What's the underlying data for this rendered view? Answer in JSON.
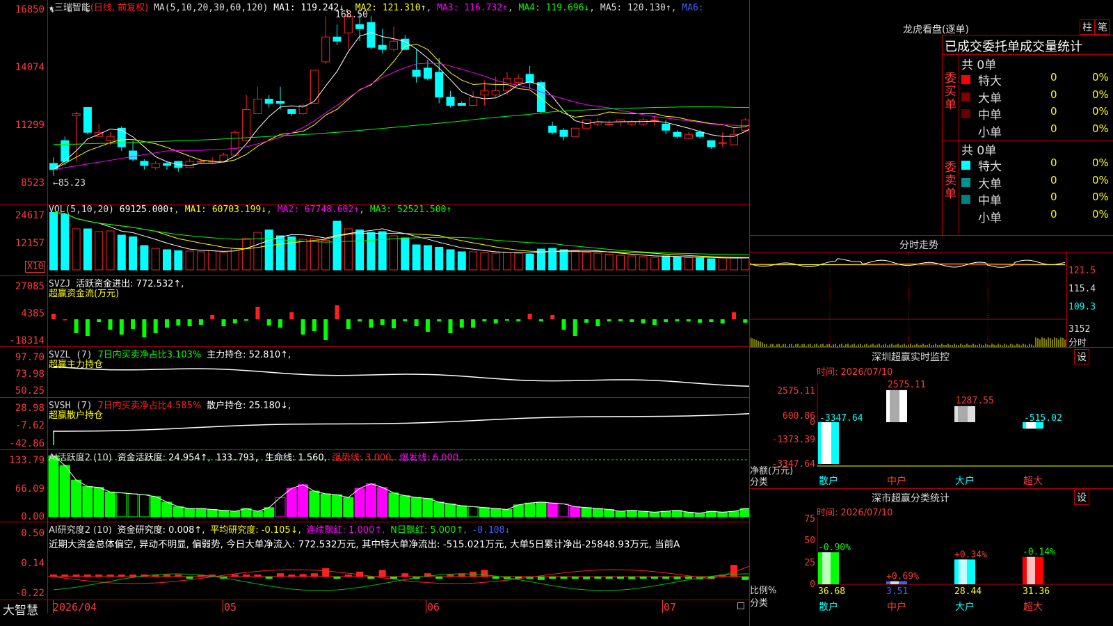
{
  "window": {
    "app_name": "大智慧"
  },
  "kline": {
    "stock": "三瑞智能",
    "period_tag": "(日线, 前复权)",
    "ma_prefix": "MA(5,10,20,30,60,120)",
    "ma1": "MA1: 119.242↓",
    "ma2": "MA2: 121.310↑",
    "ma3": "MA3: 116.732↑",
    "ma4": "MA4: 119.696↓",
    "ma5": "MA5: 120.130↑",
    "ma6": "MA6:",
    "y_ticks": [
      "16850",
      "14074",
      "11299",
      "8523"
    ],
    "high_label": "168.50",
    "low_label": "←85.23",
    "candles": [
      [
        95,
        92,
        89,
        98
      ],
      [
        106,
        96,
        94,
        108
      ],
      [
        118,
        119,
        96,
        120
      ],
      [
        122,
        110,
        109,
        122
      ],
      [
        108,
        110,
        108,
        114
      ],
      [
        106,
        108,
        104,
        110
      ],
      [
        112,
        103,
        101,
        113
      ],
      [
        101,
        97,
        96,
        106
      ],
      [
        96,
        94,
        92,
        97
      ],
      [
        93,
        95,
        92,
        96
      ],
      [
        95,
        94,
        92,
        96
      ],
      [
        96,
        93,
        91,
        96
      ],
      [
        93,
        96,
        93,
        97
      ],
      [
        96,
        96,
        95,
        97
      ],
      [
        96,
        96,
        95,
        98
      ],
      [
        96,
        99,
        96,
        100
      ],
      [
        99,
        110,
        99,
        111
      ],
      [
        106,
        121,
        106,
        128
      ],
      [
        119,
        126,
        119,
        132
      ],
      [
        126,
        124,
        122,
        128
      ],
      [
        125,
        124,
        121,
        132
      ],
      [
        121,
        119,
        118,
        121
      ],
      [
        119,
        123,
        118,
        124
      ],
      [
        124,
        140,
        124,
        140
      ],
      [
        144,
        156,
        143,
        166
      ],
      [
        156,
        154,
        152,
        162
      ],
      [
        158,
        166,
        150,
        168
      ],
      [
        162,
        160,
        154,
        168
      ],
      [
        163,
        151,
        150,
        166
      ],
      [
        152,
        150,
        148,
        160
      ],
      [
        150,
        154,
        149,
        161
      ],
      [
        155,
        150,
        150,
        157
      ],
      [
        140,
        137,
        134,
        150
      ],
      [
        141,
        136,
        135,
        145
      ],
      [
        139,
        127,
        124,
        146
      ],
      [
        127,
        123,
        122,
        130
      ],
      [
        124,
        123,
        123,
        125
      ],
      [
        123,
        127,
        123,
        130
      ],
      [
        128,
        130,
        123,
        135
      ],
      [
        128,
        130,
        127,
        137
      ],
      [
        130,
        136,
        128,
        139
      ],
      [
        134,
        136,
        133,
        138
      ],
      [
        138,
        134,
        131,
        142
      ],
      [
        134,
        120,
        119,
        135
      ],
      [
        113,
        110,
        109,
        115
      ],
      [
        111,
        108,
        106,
        112
      ],
      [
        108,
        112,
        108,
        112
      ],
      [
        112,
        116,
        112,
        116
      ],
      [
        114,
        115,
        113,
        117
      ],
      [
        114,
        114,
        113,
        116
      ],
      [
        115,
        116,
        113,
        116
      ],
      [
        114,
        115,
        113,
        116
      ],
      [
        114,
        116,
        113,
        117
      ],
      [
        116,
        116,
        113,
        118
      ],
      [
        114,
        111,
        109,
        116
      ],
      [
        110,
        108,
        107,
        111
      ],
      [
        107,
        109,
        107,
        110
      ],
      [
        110,
        108,
        107,
        111
      ],
      [
        106,
        103,
        102,
        106
      ],
      [
        105,
        105,
        103,
        110
      ],
      [
        104,
        109,
        104,
        112
      ],
      [
        111,
        116,
        110,
        117
      ],
      [
        115,
        118,
        115,
        123
      ],
      [
        118,
        134,
        118,
        145
      ],
      [
        129,
        139,
        129,
        143
      ],
      [
        143,
        145,
        134,
        152
      ],
      [
        141,
        130,
        127,
        142
      ],
      [
        129,
        120,
        118,
        132
      ],
      [
        114,
        118,
        113,
        124
      ],
      [
        115,
        112,
        110,
        117
      ],
      [
        115,
        114,
        113,
        116
      ],
      [
        116,
        120,
        115,
        123
      ],
      [
        120,
        127,
        119,
        126
      ]
    ],
    "ma_lines": {
      "ma5": [
        92.0,
        96.2,
        101.1,
        106.8,
        109.0,
        111.6,
        111.0,
        107.8,
        103.0,
        98.2,
        95.8,
        94.4,
        94.0,
        95.0,
        95.0,
        95.7,
        98.6,
        104.4,
        111.6,
        117.6,
        122.2,
        122.8,
        122.2,
        125.0,
        132.4,
        139.4,
        149.0,
        156.4,
        158.2,
        156.2,
        155.2,
        153.8,
        150.2,
        145.8,
        141.0,
        135.4,
        129.6,
        127.2,
        126.2,
        126.6,
        129.2,
        133.0,
        134.4,
        132.6,
        127.2,
        120.4,
        115.6,
        114.2,
        115.1,
        114.9,
        115.1,
        115.2,
        115.2,
        115.4,
        114.8,
        113.4,
        112.0,
        110.4,
        108.8,
        108.0,
        108.0,
        110.4,
        113.4,
        120.4,
        127.2,
        134.4,
        138.0,
        137.6,
        133.8,
        125.6,
        117.8,
        114.8,
        117.6
      ],
      "ma10": [
        92.0,
        95.0,
        98.0,
        101.0,
        103.0,
        105.0,
        106.5,
        106.5,
        105.5,
        104.5,
        102.7,
        100.6,
        98.5,
        96.6,
        96.1,
        95.6,
        96.7,
        99.3,
        103.3,
        106.3,
        109.0,
        109.6,
        110.5,
        113.6,
        118.3,
        121.1,
        126.0,
        130.6,
        132.9,
        138.1,
        144.2,
        151.5,
        152.6,
        150.0,
        144.2,
        138.7,
        135.2,
        133.1,
        133.4,
        133.1,
        133.1,
        131.1,
        130.5,
        126.4,
        121.9,
        119.2,
        117.3,
        118.0,
        118.4,
        119.8,
        119.3,
        119.0,
        119.0,
        119.0,
        117.7,
        117.3,
        116.0,
        115.2,
        114.2,
        113.8,
        112.2,
        112.7,
        114.9,
        117.7,
        120.5,
        122.1,
        123.9,
        125.2,
        127.0,
        125.3,
        124.3,
        124.1,
        123.1
      ],
      "ma20": [
        92.0,
        92.9,
        93.8,
        94.7,
        95.6,
        96.5,
        97.4,
        98.3,
        99.2,
        100.1,
        101.0,
        101.2,
        101.3,
        101.3,
        101.6,
        101.8,
        102.2,
        103.0,
        104.4,
        106.0,
        107.6,
        109.7,
        112.3,
        115.5,
        119.4,
        123.0,
        126.7,
        130.3,
        133.3,
        136.4,
        139.0,
        141.2,
        143.0,
        143.4,
        143.2,
        142.0,
        140.4,
        138.8,
        137.1,
        135.1,
        133.7,
        132.7,
        131.3,
        129.4,
        127.7,
        126.1,
        124.6,
        123.3,
        122.5,
        121.8,
        120.6,
        119.6,
        118.5,
        117.6,
        116.9,
        116.2,
        115.5,
        114.8,
        114.0,
        113.6,
        113.4,
        113.3,
        113.6,
        114.4,
        115.6,
        117.1,
        118.3,
        119.0,
        119.5,
        119.9,
        120.2,
        120.6,
        120.9
      ],
      "ma60": [
        104.1,
        104.2,
        104.3,
        104.5,
        104.6,
        104.7,
        104.9,
        105.1,
        105.3,
        105.5,
        105.7,
        105.9,
        106.1,
        106.3,
        106.5,
        106.8,
        107.1,
        107.4,
        107.7,
        108.0,
        108.3,
        108.6,
        108.9,
        109.2,
        109.6,
        110.0,
        110.4,
        110.9,
        111.4,
        111.9,
        112.4,
        112.9,
        113.4,
        113.9,
        114.4,
        114.9,
        115.5,
        116.1,
        116.7,
        117.2,
        117.7,
        118.2,
        118.7,
        119.3,
        119.9,
        120.3,
        120.5,
        120.8,
        121.1,
        121.3,
        121.5,
        121.7,
        121.8,
        122.0,
        122.1,
        122.2,
        122.3,
        122.3,
        122.3,
        122.2,
        122.1,
        122.0,
        121.9,
        121.9,
        121.9,
        121.8,
        121.7,
        121.6,
        121.4,
        121.2,
        121.0,
        120.8,
        120.6
      ]
    }
  },
  "vol": {
    "title": "VOL(5,10,20)",
    "value": "69125.000↑",
    "ma1": "MA1: 60703.199↓",
    "ma2": "MA2: 67748.602↑",
    "ma3": "MA3: 52521.500↑",
    "y_ticks": [
      "24617",
      "12157"
    ],
    "unit_badge": "X10",
    "bars": [
      165,
      160,
      118,
      118,
      110,
      112,
      100,
      95,
      70,
      62,
      58,
      55,
      54,
      52,
      55,
      50,
      62,
      90,
      108,
      115,
      98,
      95,
      88,
      90,
      85,
      140,
      118,
      115,
      108,
      110,
      98,
      92,
      72,
      70,
      65,
      58,
      52,
      52,
      50,
      48,
      50,
      48,
      45,
      60,
      62,
      58,
      55,
      50,
      48,
      45,
      42,
      40,
      38,
      36,
      40,
      38,
      35,
      34,
      32,
      34,
      35,
      36,
      40,
      98,
      108,
      90,
      75,
      62,
      55,
      48,
      45,
      42,
      60
    ]
  },
  "svzj": {
    "title": "SVZJ",
    "desc": "活跃资金进出: 772.532↑,",
    "sub": "超赢资金流(万元)",
    "y_ticks": [
      "27085",
      "4385",
      "-18314"
    ],
    "vals": [
      8,
      0,
      -20,
      -24,
      -4,
      -15,
      -22,
      -14,
      -26,
      -20,
      -12,
      -9,
      -10,
      -8,
      6,
      -10,
      -6,
      -2,
      18,
      -9,
      -12,
      10,
      -22,
      -17,
      -30,
      20,
      -14,
      -3,
      -12,
      -8,
      -13,
      -3,
      -10,
      -18,
      -3,
      -20,
      -12,
      -12,
      -3,
      -6,
      -2,
      -3,
      8,
      -3,
      6,
      -15,
      -24,
      -5,
      -10,
      -3,
      -3,
      -4,
      -6,
      -8,
      -4,
      -3,
      -3,
      -5,
      -4,
      -6,
      10,
      -5,
      -4,
      -3,
      36,
      -4,
      -13,
      -12,
      -16,
      -14,
      -12,
      -3,
      2
    ]
  },
  "svzl": {
    "title": "SVZL (7)",
    "desc": "7日内买卖净占比3.103%",
    "hold": "主力持仓: 52.810↑,",
    "sub": "超赢主力持仓",
    "y_ticks": [
      "97.70",
      "73.98",
      "50.25"
    ]
  },
  "svsh": {
    "title": "SVSH (7)",
    "desc": "7日内买卖净占比4.585%",
    "hold": "散户持仓: 25.180↓,",
    "sub": "超赢散户持仓",
    "y_ticks": [
      "28.98",
      "-7.62",
      "-42.86"
    ]
  },
  "ai_active": {
    "title": "AI活跃度2 (10)",
    "a": "资金活跃度: 24.954↑,",
    "b": "133.793,",
    "c": "生命线: 1.560,",
    "d": "强势线: 3.000,",
    "e": "爆发线: 6.000,",
    "y_ticks": [
      "133.79",
      "66.09",
      "0.00"
    ],
    "vals": [
      133,
      112,
      80,
      66,
      64,
      54,
      52,
      50,
      48,
      44,
      32,
      22,
      18,
      18,
      16,
      14,
      12,
      18,
      12,
      20,
      42,
      62,
      70,
      56,
      50,
      48,
      42,
      62,
      72,
      64,
      52,
      46,
      42,
      40,
      32,
      28,
      24,
      22,
      20,
      18,
      16,
      26,
      30,
      32,
      30,
      28,
      22,
      20,
      18,
      16,
      12,
      14,
      12,
      10,
      12,
      14,
      10,
      8,
      12,
      10,
      12,
      18,
      18,
      22,
      62,
      58,
      48,
      30,
      16,
      14,
      16,
      14,
      22
    ],
    "magenta": [
      20,
      21,
      22,
      27,
      28,
      29,
      44,
      45,
      46,
      63,
      64,
      65,
      66,
      70,
      72
    ]
  },
  "ai_research": {
    "title": "AI研究度2 (10)",
    "a": "资金研究度: 0.008↑,",
    "b": "平均研究度: -0.105↓,",
    "c": "连续飘红: 1.000↑,",
    "d": "N日飘红: 5.000↑,",
    "e": "-0.108↓",
    "summary": "近期大资金总体偏空, 异动不明显, 偏弱势, 今日大单净流入: 772.532万元, 其中特大单净流出: -515.021万元, 大单5日累计净出-25848.93万元, 当前A",
    "y_ticks": [
      "0.50",
      "0.14",
      "-0.22"
    ],
    "bars": [
      0,
      0,
      0,
      0,
      0,
      0,
      0,
      0,
      0,
      0,
      0,
      0,
      -1,
      2,
      0,
      -1,
      2,
      0,
      1,
      -2,
      4,
      0,
      3,
      4,
      10,
      -1,
      1,
      6,
      -2,
      8,
      -2,
      4,
      -2,
      4,
      -1,
      0,
      4,
      6,
      8,
      -2,
      -3,
      -2,
      -2,
      -4,
      -2,
      -2,
      -2,
      -3,
      -2,
      -2,
      -2,
      -3,
      -2,
      -2,
      -2,
      -3,
      -2,
      -3,
      -3,
      2,
      14,
      -4,
      -2,
      20,
      20,
      22,
      12,
      -2,
      -6,
      -4,
      -2,
      -2,
      -1
    ]
  },
  "xaxis": {
    "labels": [
      "2026/04",
      "05",
      "06",
      "07"
    ]
  },
  "lhb": {
    "title": "龙虎看盘(逐单)",
    "btn1": "柱",
    "btn2": "笔",
    "header": "已成交委托单成交量统计",
    "buy_side": "委买单",
    "sell_side": "委卖单",
    "buy_total": "共 0单",
    "sell_total": "共 0单",
    "buy_rows": [
      {
        "label": "特大",
        "count": "0",
        "pct": "0%",
        "color": "#ff0000"
      },
      {
        "label": "大单",
        "count": "0",
        "pct": "0%",
        "color": "#800000"
      },
      {
        "label": "中单",
        "count": "0",
        "pct": "0%",
        "color": "#600000"
      },
      {
        "label": "小单",
        "count": "0",
        "pct": "0%",
        "color": ""
      }
    ],
    "sell_rows": [
      {
        "label": "特大",
        "count": "0",
        "pct": "0%",
        "color": "#00ffff"
      },
      {
        "label": "大单",
        "count": "0",
        "pct": "0%",
        "color": "#009090"
      },
      {
        "label": "中单",
        "count": "0",
        "pct": "0%",
        "color": "#008080"
      },
      {
        "label": "小单",
        "count": "0",
        "pct": "0%",
        "color": ""
      }
    ]
  },
  "fenshi": {
    "title": "分时走势",
    "y_ticks": [
      "121.5",
      "115.4",
      "109.3"
    ],
    "vol_tick": "3152",
    "vol_label": "分时"
  },
  "sz_monitor": {
    "title": "深圳超赢实时监控",
    "btn": "设",
    "time": "时间: 2026/07/10",
    "y_ticks": [
      "2575.11",
      "600.86",
      "0",
      "-1373.39",
      "-3347.64"
    ],
    "axis_label_a": "净额(万元)",
    "axis_label_b": "分类",
    "categories": [
      "散户",
      "中户",
      "大户",
      "超大"
    ],
    "values": [
      -3347.64,
      2575.11,
      1287.55,
      -515.02
    ],
    "value_labels": [
      "-3347.64",
      "2575.11",
      "1287.55",
      "-515.02"
    ]
  },
  "sz_class": {
    "title": "深市超赢分类统计",
    "btn": "设",
    "time": "时间: 2026/07/10",
    "y_ticks": [
      "75",
      "50",
      "25",
      "0"
    ],
    "axis_label_a": "比例%",
    "axis_label_b": "分类",
    "categories": [
      "散户",
      "中户",
      "大户",
      "超大"
    ],
    "values": [
      36.68,
      3.51,
      28.44,
      31.36
    ],
    "changes": [
      "-0.90%",
      "+0.69%",
      "+0.34%",
      "-0.14%"
    ]
  },
  "colors": {
    "up": "#ff2020",
    "down": "#00ffff",
    "grid": "#c00000",
    "ma1": "#ffffff",
    "ma2": "#ffff00",
    "ma3": "#ff00ff",
    "ma4": "#00ff00"
  }
}
